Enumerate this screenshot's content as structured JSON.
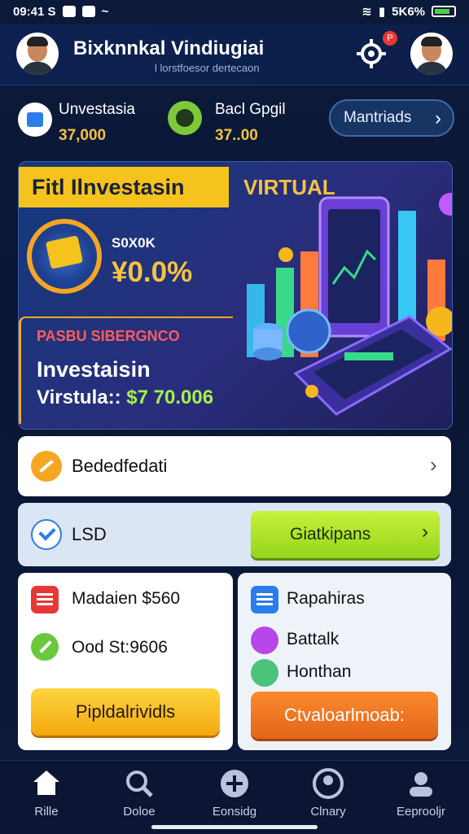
{
  "status_bar": {
    "time": "09:41 S",
    "right_text": "5K6%"
  },
  "header": {
    "title": "Bixknnkal Vindiugiai",
    "subtitle": "l lorstfoesor dertecaon",
    "notification_badge": "P"
  },
  "balances": [
    {
      "label": "Unvestasia",
      "value": "37,000"
    },
    {
      "label": "Bacl Gpgil",
      "value": "37..00"
    }
  ],
  "manage_button": {
    "label": "Mantriads"
  },
  "hero": {
    "tag": "Fitl Ilnvestasin",
    "virtual": "VIRTUAL",
    "small_label": "S0X0K",
    "percent": "¥0.0%",
    "red_label": "PASBU SIBERGNCO",
    "investasi": "Investaisin",
    "virtual_label": "Virstula::",
    "virtual_amount": "$7 70.006"
  },
  "row_white": {
    "label": "Bededfedati"
  },
  "row_blue": {
    "label": "LSD",
    "button": "Giatkipans"
  },
  "card_left": {
    "line1": "Madaien $560",
    "line2": "Ood St:9606",
    "button": "Pipldalrividls"
  },
  "card_right": {
    "line1": "Rapahiras",
    "line2": "Battalk",
    "line3": "Honthan",
    "button": "Ctvaloarlmoab:"
  },
  "bottom_nav": [
    {
      "label": "Rille",
      "icon": "home-icon"
    },
    {
      "label": "Doloe",
      "icon": "search-icon"
    },
    {
      "label": "Eonsidg",
      "icon": "plus-circle-icon"
    },
    {
      "label": "Clnary",
      "icon": "user-circle-icon"
    },
    {
      "label": "Eeprooljr",
      "icon": "profile-icon"
    }
  ],
  "colors": {
    "accent_yellow": "#f5c242",
    "accent_green": "#a6f14a",
    "bg_navy": "#0c1a3a"
  }
}
